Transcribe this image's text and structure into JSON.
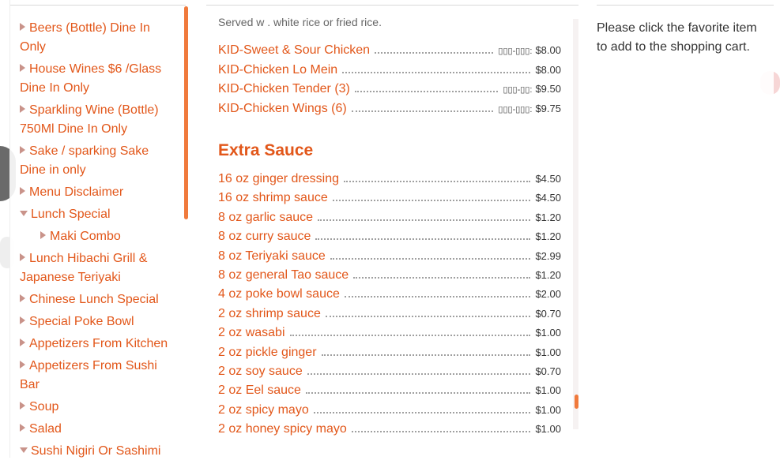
{
  "sidebar": {
    "items": [
      {
        "label": "Beers (Bottle) Dine In Only",
        "open": false
      },
      {
        "label": "House Wines $6 /Glass Dine In Only",
        "open": false
      },
      {
        "label": "Sparkling Wine (Bottle) 750Ml Dine In Only",
        "open": false
      },
      {
        "label": "Sake / sparking Sake Dine in only",
        "open": false
      },
      {
        "label": "Menu Disclaimer",
        "open": false
      },
      {
        "label": "Lunch Special",
        "open": true
      },
      {
        "label": "Maki Combo",
        "open": false,
        "sub": true
      },
      {
        "label": "Lunch Hibachi Grill & Japanese Teriyaki",
        "open": false
      },
      {
        "label": "Chinese Lunch Special",
        "open": false
      },
      {
        "label": "Special Poke Bowl",
        "open": false
      },
      {
        "label": "Appetizers From Kitchen",
        "open": false
      },
      {
        "label": "Appetizers From Sushi Bar",
        "open": false
      },
      {
        "label": "Soup",
        "open": false
      },
      {
        "label": "Salad",
        "open": false
      },
      {
        "label": "Sushi Nigiri Or Sashimi",
        "open": true
      }
    ]
  },
  "menu": {
    "served_note": "Served w . white rice or fried rice.",
    "kids": [
      {
        "name": "KID-Sweet & Sour Chicken",
        "code": "▯▯▯-▯▯▯:",
        "price": "$8.00"
      },
      {
        "name": "KID-Chicken Lo Mein",
        "code": "",
        "price": "$8.00"
      },
      {
        "name": "KID-Chicken Tender (3)",
        "code": "▯▯▯-▯▯:",
        "price": "$9.50"
      },
      {
        "name": "KID-Chicken Wings (6)",
        "code": "▯▯▯-▯▯▯:",
        "price": "$9.75"
      }
    ],
    "extra_heading": "Extra Sauce",
    "sauces": [
      {
        "name": "16 oz ginger dressing",
        "price": "$4.50"
      },
      {
        "name": "16 oz shrimp sauce",
        "price": "$4.50"
      },
      {
        "name": "8 oz garlic sauce",
        "price": "$1.20"
      },
      {
        "name": "8 oz curry sauce",
        "price": "$1.20"
      },
      {
        "name": "8 oz Teriyaki sauce",
        "price": "$2.99"
      },
      {
        "name": "8 oz general Tao sauce",
        "price": "$1.20"
      },
      {
        "name": "4 oz poke bowl sauce",
        "price": "$2.00"
      },
      {
        "name": "2 oz shrimp sauce",
        "price": "$0.70"
      },
      {
        "name": "2 oz wasabi",
        "price": "$1.00"
      },
      {
        "name": "2 oz pickle ginger",
        "price": "$1.00"
      },
      {
        "name": "2 oz soy sauce",
        "price": "$0.70"
      },
      {
        "name": "2 oz Eel sauce",
        "price": "$1.00"
      },
      {
        "name": "2 oz spicy mayo",
        "price": "$1.00"
      },
      {
        "name": "2 oz honey spicy mayo",
        "price": "$1.00"
      }
    ]
  },
  "right": {
    "message": "Please click the favorite item to add to the shopping cart."
  },
  "colors": {
    "accent": "#e2571a",
    "scroll_thumb": "#f07a3c"
  }
}
